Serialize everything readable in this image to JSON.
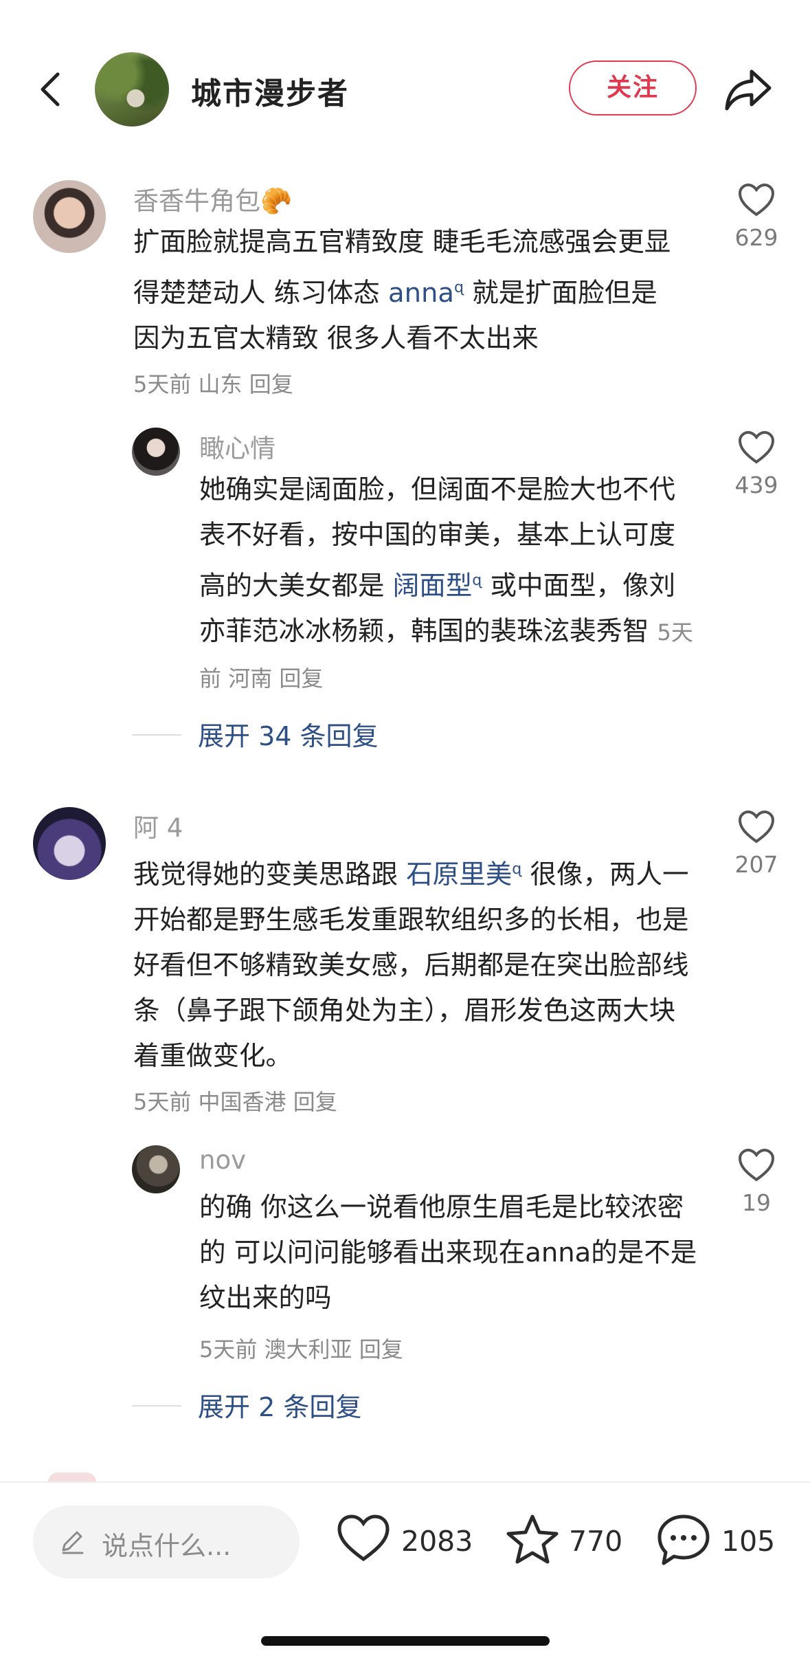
{
  "header": {
    "author_name": "城市漫步者",
    "follow_label": "关注"
  },
  "comments": [
    {
      "name": "香香牛角包🥐",
      "text_before": "扩面脸就提高五官精致度 睫毛毛流感强会更显得楚楚动人 练习体态 ",
      "mention": "anna",
      "text_after": " 就是扩面脸但是因为五官太精致 很多人看不太出来",
      "time": "5天前",
      "location": "山东",
      "reply_label": "回复",
      "likes": "629"
    },
    {
      "name": "瞰心情",
      "text_before": "她确实是阔面脸，但阔面不是脸大也不代表不好看，按中国的审美，基本上认可度高的大美女都是 ",
      "mention": "阔面型",
      "text_after": " 或中面型，像刘亦菲范冰冰杨颖，韩国的裴珠泫裴秀智",
      "time": "5天前",
      "location": "河南",
      "reply_label": "回复",
      "likes": "439"
    },
    {
      "name": "阿 4",
      "text_before": "我觉得她的变美思路跟 ",
      "mention": "石原里美",
      "text_after": " 很像，两人一开始都是野生感毛发重跟软组织多的长相，也是好看但不够精致美女感，后期都是在突出脸部线条（鼻子跟下颌角处为主），眉形发色这两大块着重做变化。",
      "time": "5天前",
      "location": "中国香港",
      "reply_label": "回复",
      "likes": "207"
    },
    {
      "name": "nov",
      "text": "的确 你这么一说看他原生眉毛是比较浓密的 可以问问能够看出来现在anna的是不是纹出来的吗",
      "time": "5天前",
      "location": "澳大利亚",
      "reply_label": "回复",
      "likes": "19"
    }
  ],
  "expand": [
    {
      "label": "展开 34 条回复"
    },
    {
      "label": "展开 2 条回复"
    }
  ],
  "bottom_bar": {
    "input_placeholder": "说点什么...",
    "likes": "2083",
    "favorites": "770",
    "comments": "105"
  },
  "colors": {
    "accent": "#e0394f",
    "mention": "#2d4f86",
    "meta": "#8a8a8a"
  },
  "icons": [
    "back-arrow-icon",
    "share-icon",
    "heart-icon",
    "star-icon",
    "comment-bubble-icon",
    "pencil-icon"
  ]
}
